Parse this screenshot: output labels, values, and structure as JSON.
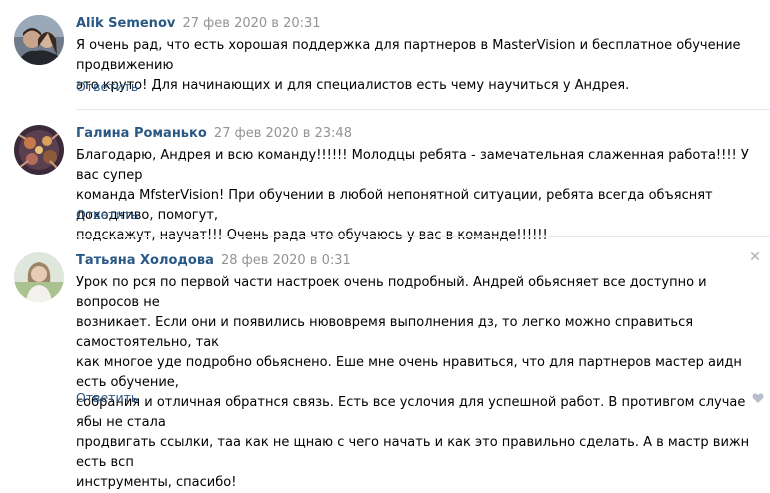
{
  "comments": [
    {
      "author": "Alik Semenov",
      "date": "27 фев 2020 в 20:31",
      "lines": [
        "Я очень рад, что есть хорошая поддержка для партнеров в MasterVision и бесплатное обучение продвижению",
        "это круто! Для начинающих и для специалистов есть чему научиться у Андрея."
      ],
      "reply_label": "Ответить"
    },
    {
      "author": "Галина Романько",
      "date": "27 фев 2020 в 23:48",
      "lines": [
        "Благодарю, Андрея и всю команду!!!!!! Молодцы ребята - замечательная слаженная работа!!!! У вас супер",
        "команда MfsterVision! При обучении в любой непонятной ситуации, ребята всегда объяснят доходчиво, помогут,",
        "подскажут, научат!!! Очень рада что обучаюсь у вас в команде!!!!!!"
      ],
      "reply_label": "Ответить"
    },
    {
      "author": "Татьяна Холодова",
      "date": "28 фев 2020 в 0:31",
      "lines": [
        "Урок по рся по первой части настроек очень подробный. Андрей обьясняет все доступно и вопросов не",
        "возникает. Если они и появились нювовремя выполнения дз, то легко можно справиться самостоятельно, так",
        "как многое уде подробно обьяснено. Еше мне очень нравиться, что для партнеров мастер аидн есть обучение,",
        "собрания и отличная обратнся связь. Есть все услочия для успешной работ. В противгом случае ябы не стала",
        "продвигать ссылки, таа как не щнаю с чего начать и как это правильно сделать. А в мастр вижн есть всп",
        "инструменты, спасибо!"
      ],
      "reply_label": "Ответить",
      "close_icon": "close-icon",
      "like_icon": "heart-icon"
    }
  ],
  "colors": {
    "author": "#2a5885",
    "date": "#939393",
    "divider": "#e7e8ec"
  }
}
